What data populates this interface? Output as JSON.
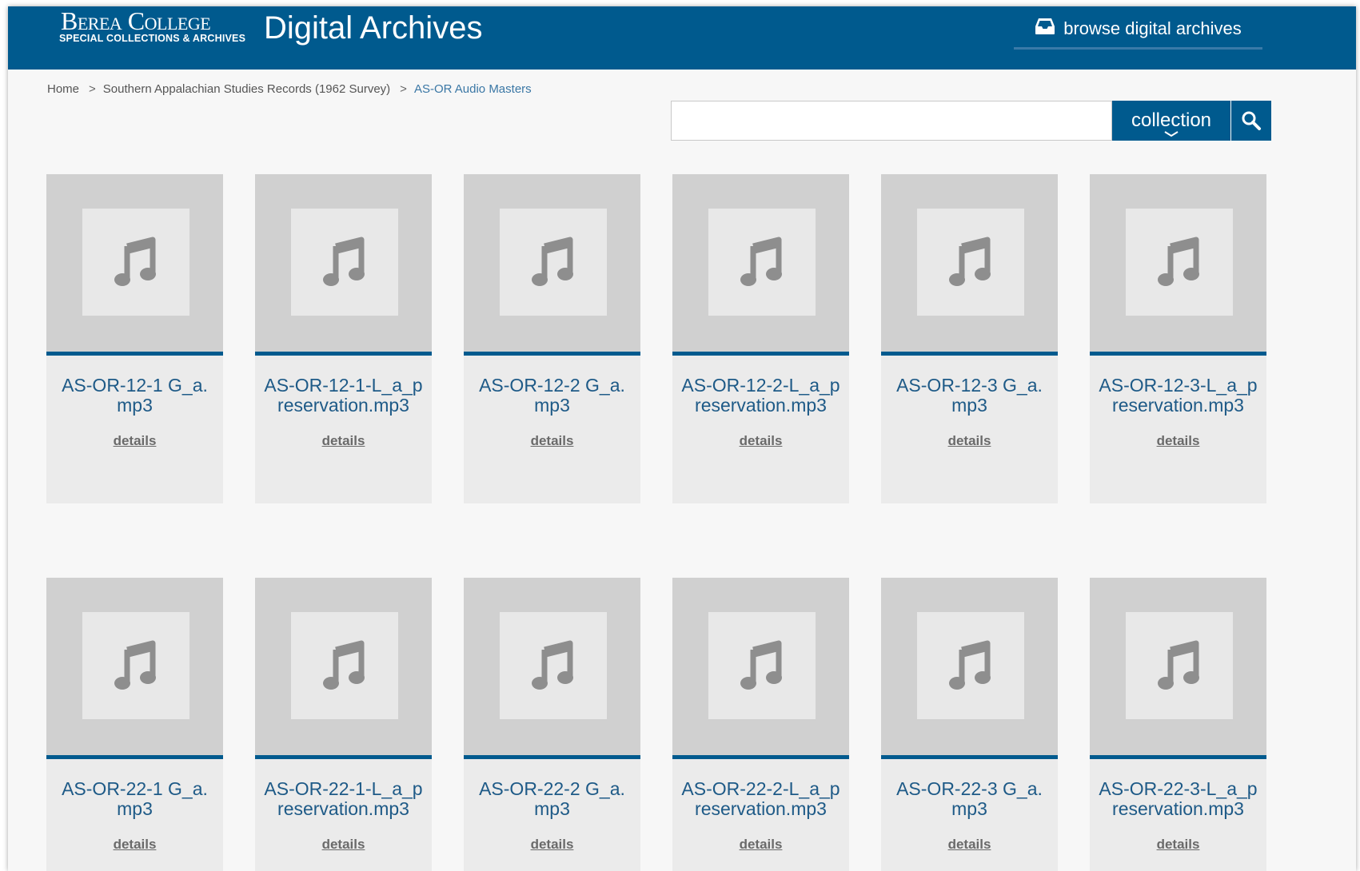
{
  "header": {
    "logo_line1": "Berea College",
    "logo_line2": "SPECIAL COLLECTIONS & ARCHIVES",
    "site_title": "Digital Archives",
    "browse_label": "browse digital archives",
    "browse_icon": "inbox-tray-icon",
    "bg_color": "#005a8e"
  },
  "breadcrumb": [
    {
      "label": "Home"
    },
    {
      "label": "Southern Appalachian Studies Records (1962 Survey)"
    },
    {
      "label": "AS-OR Audio Masters",
      "current": true
    }
  ],
  "search": {
    "value": "",
    "scope_label": "collection",
    "scope_icon": "chevron-down-icon",
    "button_icon": "search-icon"
  },
  "items": [
    {
      "title": "AS-OR-12-1 G_a.mp3",
      "details_label": "details",
      "icon": "music-note-icon"
    },
    {
      "title": "AS-OR-12-1-L_a_preservation.mp3",
      "details_label": "details",
      "icon": "music-note-icon"
    },
    {
      "title": "AS-OR-12-2 G_a.mp3",
      "details_label": "details",
      "icon": "music-note-icon"
    },
    {
      "title": "AS-OR-12-2-L_a_preservation.mp3",
      "details_label": "details",
      "icon": "music-note-icon"
    },
    {
      "title": "AS-OR-12-3 G_a.mp3",
      "details_label": "details",
      "icon": "music-note-icon"
    },
    {
      "title": "AS-OR-12-3-L_a_preservation.mp3",
      "details_label": "details",
      "icon": "music-note-icon"
    },
    {
      "title": "AS-OR-22-1 G_a.mp3",
      "details_label": "details",
      "icon": "music-note-icon"
    },
    {
      "title": "AS-OR-22-1-L_a_preservation.mp3",
      "details_label": "details",
      "icon": "music-note-icon"
    },
    {
      "title": "AS-OR-22-2 G_a.mp3",
      "details_label": "details",
      "icon": "music-note-icon"
    },
    {
      "title": "AS-OR-22-2-L_a_preservation.mp3",
      "details_label": "details",
      "icon": "music-note-icon"
    },
    {
      "title": "AS-OR-22-3 G_a.mp3",
      "details_label": "details",
      "icon": "music-note-icon"
    },
    {
      "title": "AS-OR-22-3-L_a_preservation.mp3",
      "details_label": "details",
      "icon": "music-note-icon"
    }
  ]
}
